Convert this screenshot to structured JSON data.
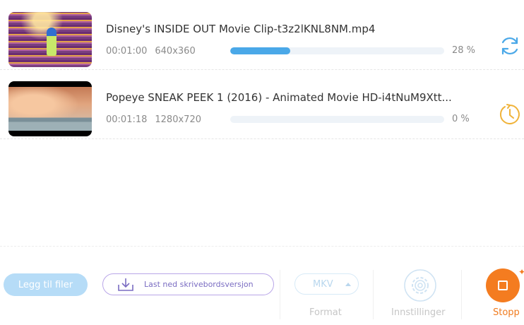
{
  "queue": [
    {
      "title": "Disney's INSIDE OUT Movie Clip-t3z2lKNL8NM.mp4",
      "duration": "00:01:00",
      "resolution": "640x360",
      "progress_percent": 28,
      "progress_text": "28 %",
      "status_icon": "converting-refresh-icon",
      "status_color": "#4aa8e8"
    },
    {
      "title": "Popeye SNEAK PEEK 1 (2016) - Animated Movie HD-i4tNuM9Xtt...",
      "duration": "00:01:18",
      "resolution": "1280x720",
      "progress_percent": 0,
      "progress_text": "0 %",
      "status_icon": "waiting-clock-icon",
      "status_color": "#f0b33a"
    }
  ],
  "toolbar": {
    "add_files_label": "Legg til filer",
    "download_desktop_label": "Last ned skrivebordsversjon",
    "format_value": "MKV",
    "format_label": "Format",
    "settings_label": "Innstillinger",
    "stop_label": "Stopp"
  },
  "colors": {
    "accent_blue": "#4aa8e8",
    "stop_orange": "#f47c20",
    "download_purple": "#7a6cc2"
  }
}
